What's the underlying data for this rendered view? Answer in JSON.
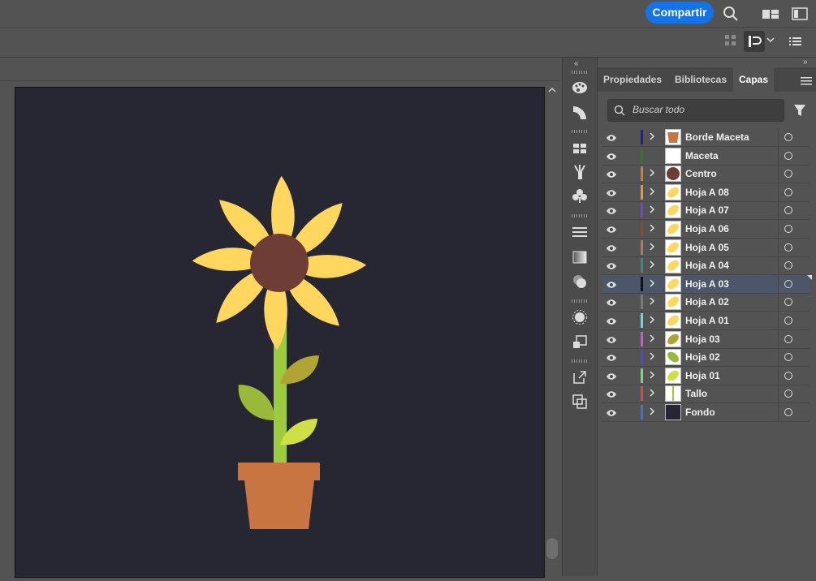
{
  "topbar": {
    "share_label": "Compartir"
  },
  "panel": {
    "tabs": [
      {
        "label": "Propiedades",
        "active": false
      },
      {
        "label": "Bibliotecas",
        "active": false
      },
      {
        "label": "Capas",
        "active": true
      }
    ],
    "search_placeholder": "Buscar todo"
  },
  "layers": [
    {
      "name": "Borde Maceta",
      "color": "#1d1da8",
      "expandable": true,
      "thumb": "pot",
      "selected": false
    },
    {
      "name": "Maceta",
      "color": "#2e7d1a",
      "expandable": false,
      "thumb": "blank",
      "selected": false
    },
    {
      "name": "Centro",
      "color": "#d97a2b",
      "expandable": true,
      "thumb": "circle",
      "selected": false
    },
    {
      "name": "Hoja A 08",
      "color": "#e89a2c",
      "expandable": true,
      "thumb": "petal",
      "selected": false
    },
    {
      "name": "Hoja A 07",
      "color": "#7d3fd6",
      "expandable": true,
      "thumb": "petal",
      "selected": false
    },
    {
      "name": "Hoja A 06",
      "color": "#8a4a2a",
      "expandable": true,
      "thumb": "petal",
      "selected": false
    },
    {
      "name": "Hoja A 05",
      "color": "#b07a52",
      "expandable": true,
      "thumb": "petal",
      "selected": false
    },
    {
      "name": "Hoja A 04",
      "color": "#3a8a8a",
      "expandable": true,
      "thumb": "petal",
      "selected": false
    },
    {
      "name": "Hoja A 03",
      "color": "#111111",
      "expandable": true,
      "thumb": "petal",
      "selected": true
    },
    {
      "name": "Hoja A 02",
      "color": "#7a7a7a",
      "expandable": true,
      "thumb": "petal",
      "selected": false
    },
    {
      "name": "Hoja A 01",
      "color": "#5ce0e0",
      "expandable": true,
      "thumb": "petal",
      "selected": false
    },
    {
      "name": "Hoja 03",
      "color": "#d94fd9",
      "expandable": true,
      "thumb": "leaf-olive",
      "selected": false
    },
    {
      "name": "Hoja 02",
      "color": "#4a4ad9",
      "expandable": true,
      "thumb": "leaf-green",
      "selected": false
    },
    {
      "name": "Hoja 01",
      "color": "#6ee06e",
      "expandable": true,
      "thumb": "leaf-lime",
      "selected": false
    },
    {
      "name": "Tallo",
      "color": "#d94a4a",
      "expandable": true,
      "thumb": "stem",
      "selected": false
    },
    {
      "name": "Fondo",
      "color": "#4a6ed9",
      "expandable": true,
      "thumb": "dark",
      "selected": false
    }
  ],
  "colors": {
    "background": "#272733",
    "petal": "#ffd75e",
    "center": "#6e3e36",
    "stem": "#9ccc3d",
    "leaf_left": "#9ab83a",
    "leaf_top": "#b0a534",
    "leaf_bottom": "#cfe046",
    "pot": "#c97542"
  }
}
